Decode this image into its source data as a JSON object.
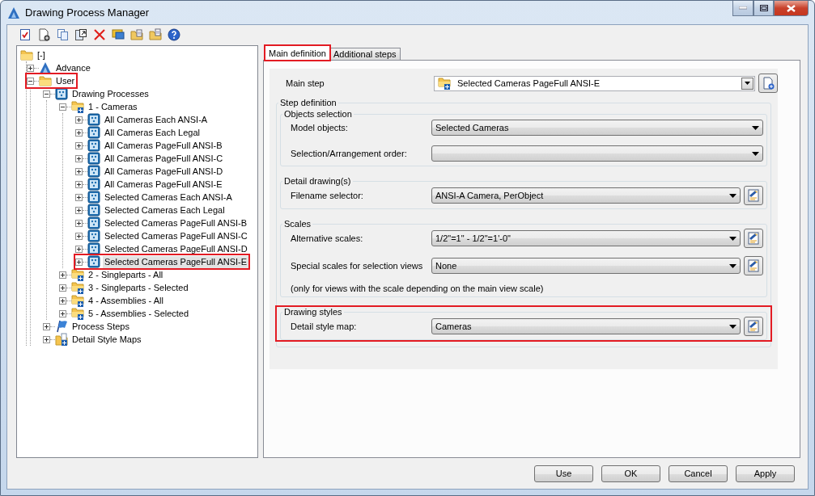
{
  "window": {
    "title": "Drawing Process Manager"
  },
  "tree": [
    {
      "label": "[-]",
      "kind": "folder",
      "selected": false,
      "highlighted": false,
      "children": [
        {
          "label": "Advance",
          "kind": "logo",
          "expanded": false,
          "selected": false,
          "highlighted": false
        },
        {
          "label": "User",
          "kind": "folder",
          "expanded": true,
          "selected": false,
          "highlighted": true,
          "children": [
            {
              "label": "Drawing Processes",
              "kind": "process",
              "expanded": true,
              "selected": false,
              "highlighted": false,
              "children": [
                {
                  "label": "1 - Cameras",
                  "kind": "step-folder",
                  "expanded": true,
                  "selected": false,
                  "highlighted": false,
                  "children": [
                    {
                      "label": "All Cameras Each ANSI-A",
                      "kind": "process",
                      "expanded": false,
                      "selected": false,
                      "highlighted": false
                    },
                    {
                      "label": "All Cameras Each Legal",
                      "kind": "process",
                      "expanded": false,
                      "selected": false,
                      "highlighted": false
                    },
                    {
                      "label": "All Cameras PageFull ANSI-B",
                      "kind": "process",
                      "expanded": false,
                      "selected": false,
                      "highlighted": false
                    },
                    {
                      "label": "All Cameras PageFull ANSI-C",
                      "kind": "process",
                      "expanded": false,
                      "selected": false,
                      "highlighted": false
                    },
                    {
                      "label": "All Cameras PageFull ANSI-D",
                      "kind": "process",
                      "expanded": false,
                      "selected": false,
                      "highlighted": false
                    },
                    {
                      "label": "All Cameras PageFull ANSI-E",
                      "kind": "process",
                      "expanded": false,
                      "selected": false,
                      "highlighted": false
                    },
                    {
                      "label": "Selected Cameras Each ANSI-A",
                      "kind": "process",
                      "expanded": false,
                      "selected": false,
                      "highlighted": false
                    },
                    {
                      "label": "Selected Cameras Each Legal",
                      "kind": "process",
                      "expanded": false,
                      "selected": false,
                      "highlighted": false
                    },
                    {
                      "label": "Selected Cameras PageFull ANSI-B",
                      "kind": "process",
                      "expanded": false,
                      "selected": false,
                      "highlighted": false
                    },
                    {
                      "label": "Selected Cameras PageFull ANSI-C",
                      "kind": "process",
                      "expanded": false,
                      "selected": false,
                      "highlighted": false
                    },
                    {
                      "label": "Selected Cameras PageFull ANSI-D",
                      "kind": "process",
                      "expanded": false,
                      "selected": false,
                      "highlighted": false
                    },
                    {
                      "label": "Selected Cameras PageFull ANSI-E",
                      "kind": "process",
                      "expanded": false,
                      "selected": true,
                      "highlighted": true
                    }
                  ]
                },
                {
                  "label": "2 - Singleparts - All",
                  "kind": "step-folder",
                  "expanded": false,
                  "selected": false,
                  "highlighted": false
                },
                {
                  "label": "3 - Singleparts - Selected",
                  "kind": "step-folder",
                  "expanded": false,
                  "selected": false,
                  "highlighted": false
                },
                {
                  "label": "4 - Assemblies - All",
                  "kind": "step-folder",
                  "expanded": false,
                  "selected": false,
                  "highlighted": false
                },
                {
                  "label": "5 - Assemblies - Selected",
                  "kind": "step-folder",
                  "expanded": false,
                  "selected": false,
                  "highlighted": false
                }
              ]
            },
            {
              "label": "Process Steps",
              "kind": "flag",
              "expanded": false,
              "selected": false,
              "highlighted": false
            },
            {
              "label": "Detail Style Maps",
              "kind": "map-folder",
              "expanded": false,
              "selected": false,
              "highlighted": false
            }
          ]
        }
      ]
    }
  ],
  "tabs": [
    {
      "label": "Main definition",
      "selected": true,
      "highlighted": true
    },
    {
      "label": "Additional steps",
      "selected": false,
      "highlighted": false
    }
  ],
  "main_step": {
    "label": "Main step",
    "value": "Selected Cameras PageFull ANSI-E"
  },
  "step_definition": {
    "title": "Step definition",
    "groups": [
      {
        "title": "Objects selection",
        "highlighted": false,
        "rows": [
          {
            "kind": "combo",
            "label": "Model objects:",
            "value": "Selected Cameras",
            "edit_button": false
          },
          {
            "kind": "combo",
            "label": "Selection/Arrangement order:",
            "edit_button": false
          }
        ]
      },
      {
        "title": "Detail drawing(s)",
        "highlighted": false,
        "rows": [
          {
            "kind": "combo",
            "label": "Filename selector:",
            "value": "ANSI-A Camera, PerObject",
            "edit_button": true
          }
        ]
      },
      {
        "title": "Scales",
        "highlighted": false,
        "rows": [
          {
            "kind": "combo",
            "label": "Alternative scales:",
            "value": "1/2\"=1\" - 1/2\"=1'-0\"",
            "edit_button": true
          },
          {
            "kind": "combo",
            "label": "Special scales for selection views",
            "value": "None",
            "edit_button": true
          },
          {
            "kind": "note",
            "text": "(only for views with the scale depending on the main view scale)"
          }
        ]
      },
      {
        "title": "Drawing styles",
        "highlighted": true,
        "rows": [
          {
            "kind": "combo",
            "label": "Detail style map:",
            "value": "Cameras",
            "edit_button": true
          }
        ]
      }
    ]
  },
  "buttons": [
    "Use",
    "OK",
    "Cancel",
    "Apply"
  ]
}
